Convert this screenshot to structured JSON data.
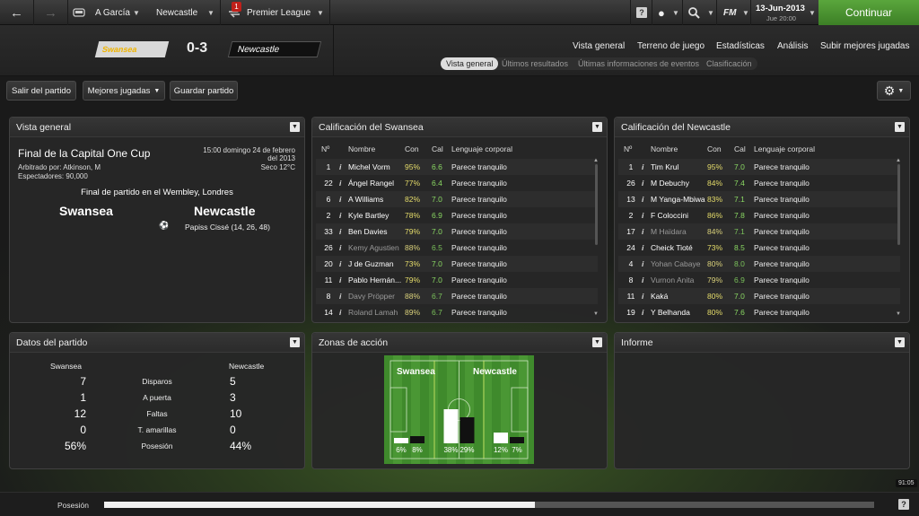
{
  "topbar": {
    "back_icon": "back-arrow-icon",
    "forward_icon": "forward-arrow-icon",
    "manager": "A García",
    "club": "Newcastle",
    "competition": "Premier League",
    "comp_badge": "1",
    "date": "13-Jun-2013",
    "day": "Jue 20:00",
    "fm_label": "FM",
    "continue_label": "Continuar"
  },
  "header": {
    "home_team": "Swansea",
    "away_team": "Newcastle",
    "score": "0-3",
    "tabs": [
      "Vista general",
      "Terreno de juego",
      "Estadísticas",
      "Análisis",
      "Subir mejores jugadas"
    ],
    "subtabs": [
      "Vista general",
      "Últimos resultados",
      "Últimas informaciones de eventos",
      "Clasificación"
    ]
  },
  "toolbar": {
    "exit": "Salir del partido",
    "best": "Mejores jugadas",
    "save": "Guardar partido"
  },
  "overview": {
    "title": "Vista general",
    "competition": "Final de la Capital One Cup",
    "referee": "Arbitrado por: Atkinson, M",
    "spectators": "Espectadores: 90,000",
    "datetime1": "15:00 domingo 24 de febrero",
    "datetime2": "del 2013",
    "weather": "Seco 12°C",
    "venue": "Final de partido en el Wembley, Londres",
    "home": "Swansea",
    "away": "Newcastle",
    "scorer": "Papiss Cissé (14, 26, 48)"
  },
  "ratings_home": {
    "title": "Calificación del Swansea",
    "cols": [
      "Nº",
      "Nombre",
      "Con",
      "Cal",
      "Lenguaje corporal"
    ],
    "rows": [
      {
        "n": "1",
        "name": "Michel Vorm",
        "con": "95%",
        "cal": "6.6",
        "body": "Parece tranquilo",
        "dim": false
      },
      {
        "n": "22",
        "name": "Ángel Rangel",
        "con": "77%",
        "cal": "6.4",
        "body": "Parece tranquilo",
        "dim": false
      },
      {
        "n": "6",
        "name": "A Williams",
        "con": "82%",
        "cal": "7.0",
        "body": "Parece tranquilo",
        "dim": false
      },
      {
        "n": "2",
        "name": "Kyle Bartley",
        "con": "78%",
        "cal": "6.9",
        "body": "Parece tranquilo",
        "dim": false
      },
      {
        "n": "33",
        "name": "Ben Davies",
        "con": "79%",
        "cal": "7.0",
        "body": "Parece tranquilo",
        "dim": false
      },
      {
        "n": "26",
        "name": "Kemy Agustien",
        "con": "88%",
        "cal": "6.5",
        "body": "Parece tranquilo",
        "dim": true
      },
      {
        "n": "20",
        "name": "J de Guzman",
        "con": "73%",
        "cal": "7.0",
        "body": "Parece tranquilo",
        "dim": false
      },
      {
        "n": "11",
        "name": "Pablo Hernán...",
        "con": "79%",
        "cal": "7.0",
        "body": "Parece tranquilo",
        "dim": false
      },
      {
        "n": "8",
        "name": "Davy Pröpper",
        "con": "88%",
        "cal": "6.7",
        "body": "Parece tranquilo",
        "dim": true
      },
      {
        "n": "14",
        "name": "Roland Lamah",
        "con": "89%",
        "cal": "6.7",
        "body": "Parece tranquilo",
        "dim": true
      }
    ]
  },
  "ratings_away": {
    "title": "Calificación del Newcastle",
    "cols": [
      "Nº",
      "Nombre",
      "Con",
      "Cal",
      "Lenguaje corporal"
    ],
    "rows": [
      {
        "n": "1",
        "name": "Tim Krul",
        "con": "95%",
        "cal": "7.0",
        "body": "Parece tranquilo",
        "dim": false
      },
      {
        "n": "26",
        "name": "M Debuchy",
        "con": "84%",
        "cal": "7.4",
        "body": "Parece tranquilo",
        "dim": false
      },
      {
        "n": "13",
        "name": "M Yanga-Mbiwa",
        "con": "83%",
        "cal": "7.1",
        "body": "Parece tranquilo",
        "dim": false
      },
      {
        "n": "2",
        "name": "F Coloccini",
        "con": "86%",
        "cal": "7.8",
        "body": "Parece tranquilo",
        "dim": false
      },
      {
        "n": "17",
        "name": "M Haïdara",
        "con": "84%",
        "cal": "7.1",
        "body": "Parece tranquilo",
        "dim": true
      },
      {
        "n": "24",
        "name": "Cheick Tioté",
        "con": "73%",
        "cal": "8.5",
        "body": "Parece tranquilo",
        "dim": false
      },
      {
        "n": "4",
        "name": "Yohan Cabaye",
        "con": "80%",
        "cal": "8.0",
        "body": "Parece tranquilo",
        "dim": true
      },
      {
        "n": "8",
        "name": "Vurnon Anita",
        "con": "79%",
        "cal": "6.9",
        "body": "Parece tranquilo",
        "dim": true
      },
      {
        "n": "11",
        "name": "Kaká",
        "con": "80%",
        "cal": "7.0",
        "body": "Parece tranquilo",
        "dim": false
      },
      {
        "n": "19",
        "name": "Y Belhanda",
        "con": "80%",
        "cal": "7.6",
        "body": "Parece tranquilo",
        "dim": false
      }
    ]
  },
  "stats": {
    "title": "Datos del partido",
    "home": "Swansea",
    "away": "Newcastle",
    "rows": [
      {
        "label": "Disparos",
        "h": "7",
        "a": "5"
      },
      {
        "label": "A puerta",
        "h": "1",
        "a": "3"
      },
      {
        "label": "Faltas",
        "h": "12",
        "a": "10"
      },
      {
        "label": "T. amarillas",
        "h": "0",
        "a": "0"
      },
      {
        "label": "Posesión",
        "h": "56%",
        "a": "44%"
      }
    ]
  },
  "zones": {
    "title": "Zonas de acción",
    "home": "Swansea",
    "away": "Newcastle",
    "values": [
      {
        "home": 6,
        "away": 8,
        "home_label": "6%",
        "away_label": "8%"
      },
      {
        "home": 38,
        "away": 29,
        "home_label": "38%",
        "away_label": "29%"
      },
      {
        "home": 12,
        "away": 7,
        "home_label": "12%",
        "away_label": "7%"
      }
    ]
  },
  "report": {
    "title": "Informe"
  },
  "footer": {
    "possession_label": "Posesión",
    "possession_home": 56,
    "clock": "91:05",
    "help": "?"
  }
}
